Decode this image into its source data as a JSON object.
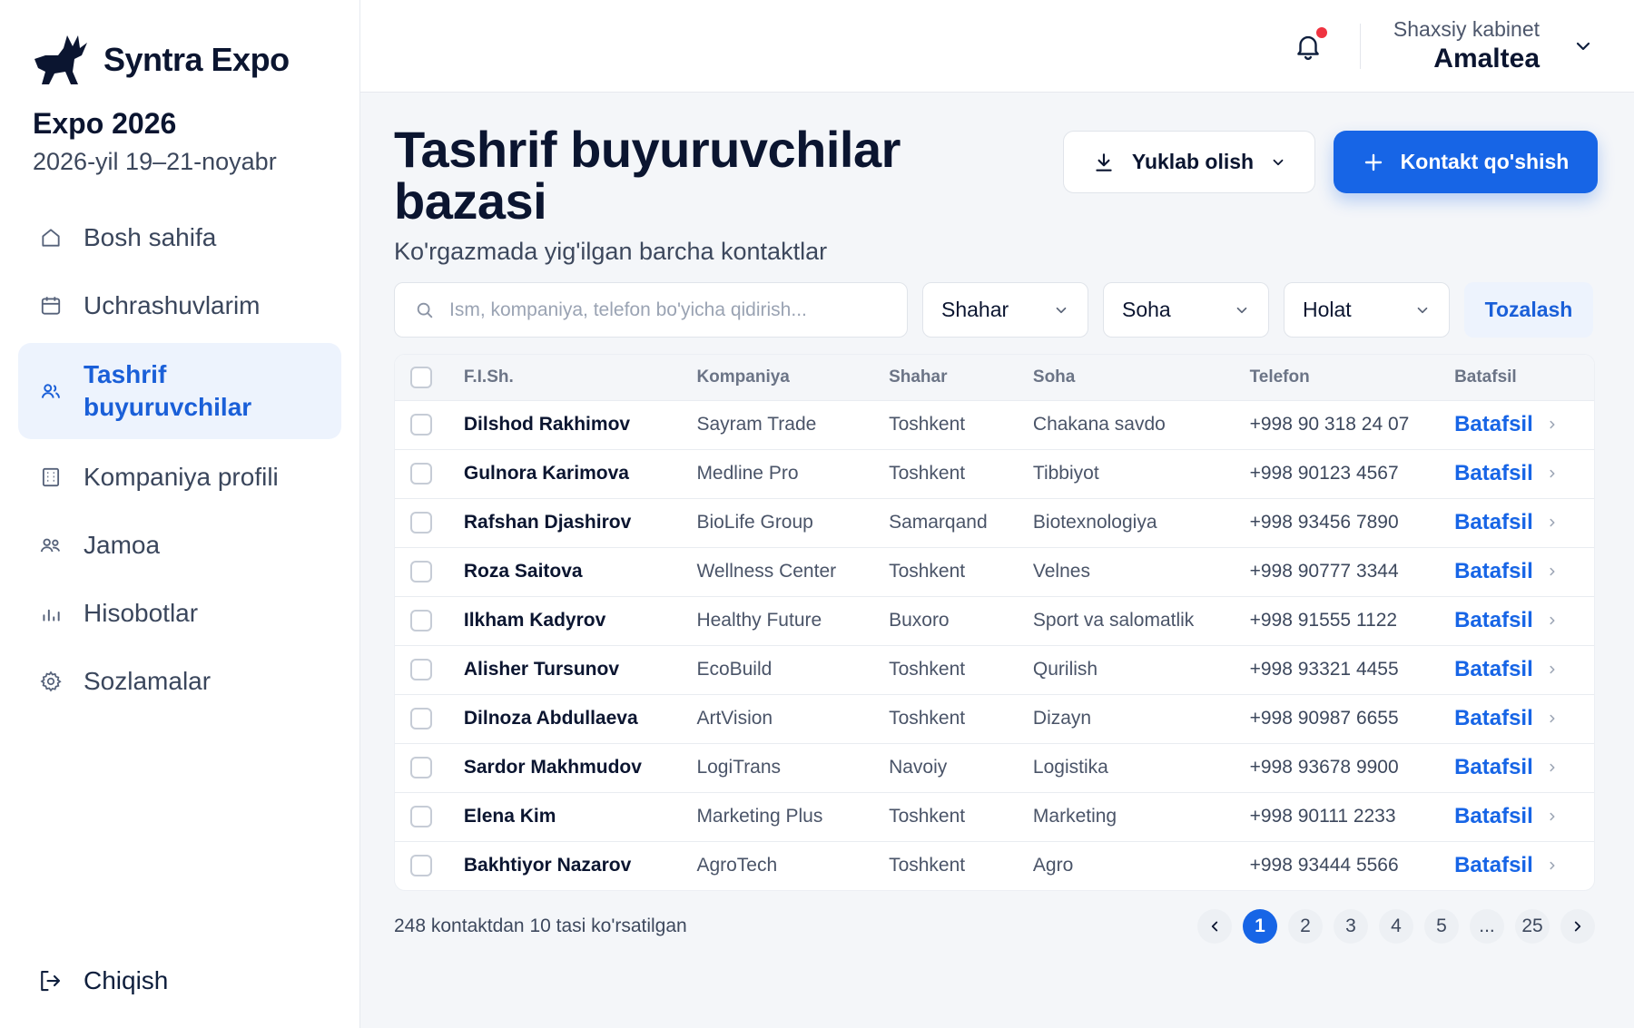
{
  "brand": {
    "name": "Syntra Expo"
  },
  "expo": {
    "title": "Expo 2026",
    "date": "2026-yil 19–21-noyabr"
  },
  "sidebar": {
    "items": [
      {
        "label": "Bosh sahifa",
        "icon": "home-icon"
      },
      {
        "label": "Uchrashuvlarim",
        "icon": "calendar-icon"
      },
      {
        "label": "Tashrif buyuruvchilar",
        "icon": "users-icon",
        "active": true
      },
      {
        "label": "Kompaniya profili",
        "icon": "building-icon"
      },
      {
        "label": "Jamoa",
        "icon": "team-icon"
      },
      {
        "label": "Hisobotlar",
        "icon": "chart-icon"
      },
      {
        "label": "Sozlamalar",
        "icon": "gear-icon"
      }
    ],
    "logout_label": "Chiqish"
  },
  "topbar": {
    "account_label": "Shaxsiy kabinet",
    "account_name": "Amaltea"
  },
  "page": {
    "title": "Tashrif buyuruvchilar bazasi",
    "subtitle": "Ko'rgazmada yig'ilgan barcha kontaktlar",
    "download_label": "Yuklab olish",
    "add_label": "Kontakt qo'shish"
  },
  "filters": {
    "search_placeholder": "Ism, kompaniya, telefon bo'yicha qidirish...",
    "city_label": "Shahar",
    "field_label": "Soha",
    "status_label": "Holat",
    "clear_label": "Tozalash"
  },
  "table": {
    "headers": {
      "name": "F.I.Sh.",
      "company": "Kompaniya",
      "city": "Shahar",
      "field": "Soha",
      "phone": "Telefon",
      "details": "Batafsil"
    },
    "detail_label": "Batafsil",
    "rows": [
      {
        "name": "Dilshod Rakhimov",
        "company": "Sayram Trade",
        "city": "Toshkent",
        "field": "Chakana savdo",
        "phone": "+998 90 318 24 07"
      },
      {
        "name": "Gulnora Karimova",
        "company": "Medline Pro",
        "city": "Toshkent",
        "field": "Tibbiyot",
        "phone": "+998 90123 4567"
      },
      {
        "name": "Rafshan Djashirov",
        "company": "BioLife Group",
        "city": "Samarqand",
        "field": "Biotexnologiya",
        "phone": "+998 93456 7890"
      },
      {
        "name": "Roza Saitova",
        "company": "Wellness Center",
        "city": "Toshkent",
        "field": "Velnes",
        "phone": "+998 90777 3344"
      },
      {
        "name": "Ilkham Kadyrov",
        "company": "Healthy Future",
        "city": "Buxoro",
        "field": "Sport va salomatlik",
        "phone": "+998 91555 1122"
      },
      {
        "name": "Alisher Tursunov",
        "company": "EcoBuild",
        "city": "Toshkent",
        "field": "Qurilish",
        "phone": "+998 93321 4455"
      },
      {
        "name": "Dilnoza Abdullaeva",
        "company": "ArtVision",
        "city": "Toshkent",
        "field": "Dizayn",
        "phone": "+998 90987 6655"
      },
      {
        "name": "Sardor Makhmudov",
        "company": "LogiTrans",
        "city": "Navoiy",
        "field": "Logistika",
        "phone": "+998 93678 9900"
      },
      {
        "name": "Elena Kim",
        "company": "Marketing Plus",
        "city": "Toshkent",
        "field": "Marketing",
        "phone": "+998 90111 2233"
      },
      {
        "name": "Bakhtiyor Nazarov",
        "company": "AgroTech",
        "city": "Toshkent",
        "field": "Agro",
        "phone": "+998 93444 5566"
      }
    ]
  },
  "footer": {
    "count_text": "248 kontaktdan 10 tasi ko'rsatilgan",
    "pages": [
      "1",
      "2",
      "3",
      "4",
      "5",
      "...",
      "25"
    ],
    "current_page": "1"
  },
  "colors": {
    "accent": "#1765e6",
    "notification": "#ef3340",
    "active_bg": "#edf3fd"
  }
}
